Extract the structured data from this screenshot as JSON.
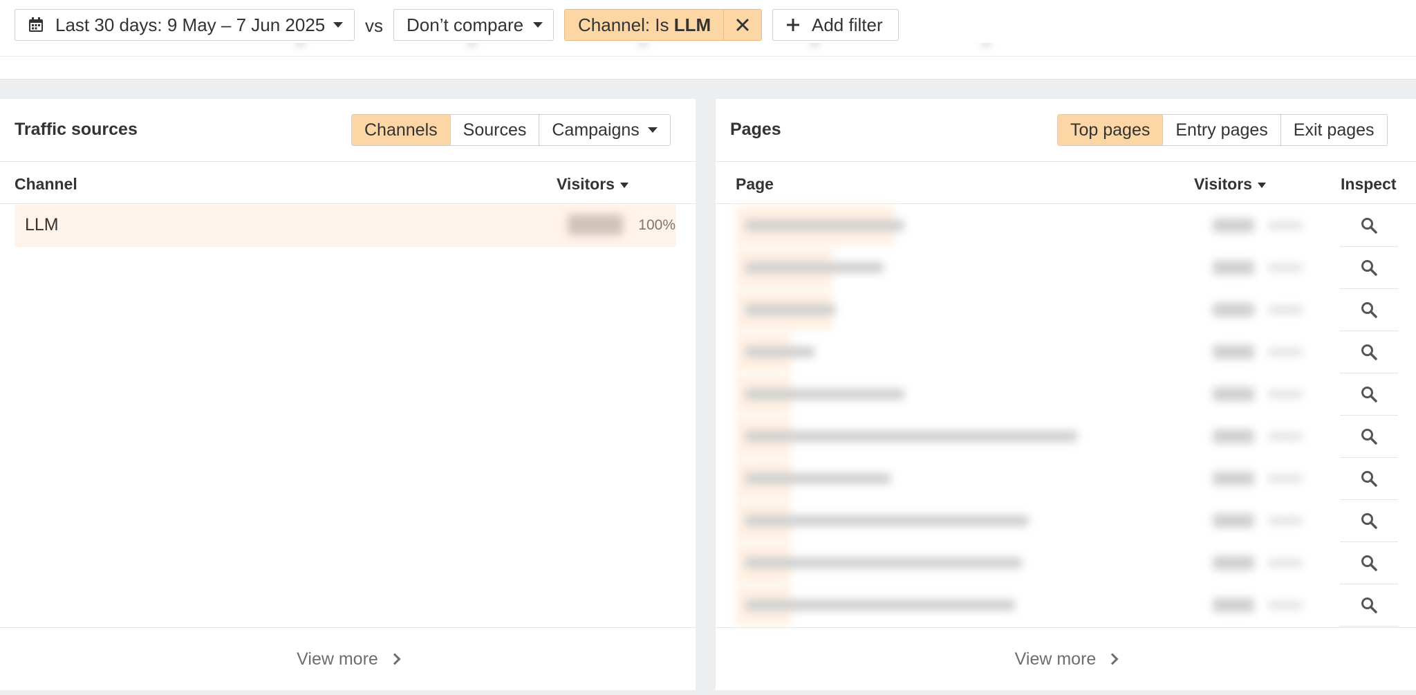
{
  "filters": {
    "date_range_label": "Last 30 days: 9 May – 7 Jun 2025",
    "vs_label": "vs",
    "compare_label": "Don’t compare",
    "channel_filter_prefix": "Channel: Is ",
    "channel_filter_value": "LLM",
    "add_filter_label": "Add filter"
  },
  "traffic_sources": {
    "title": "Traffic sources",
    "tabs": [
      {
        "label": "Channels",
        "active": true
      },
      {
        "label": "Sources",
        "active": false
      },
      {
        "label": "Campaigns",
        "active": false
      }
    ],
    "columns": {
      "channel": "Channel",
      "visitors": "Visitors"
    },
    "rows": [
      {
        "channel": "LLM",
        "percent": "100%",
        "share": 1.0
      }
    ],
    "view_more": "View more"
  },
  "pages": {
    "title": "Pages",
    "tabs": [
      {
        "label": "Top pages",
        "active": true
      },
      {
        "label": "Entry pages",
        "active": false
      },
      {
        "label": "Exit pages",
        "active": false
      }
    ],
    "columns": {
      "page": "Page",
      "visitors": "Visitors",
      "inspect": "Inspect"
    },
    "row_count": 10,
    "view_more": "View more"
  },
  "colors": {
    "accent": "#fdd6a6",
    "accent_light": "#fff3ea",
    "text": "#333333",
    "muted": "#6d6d6d",
    "background_gray": "#eceef0"
  }
}
